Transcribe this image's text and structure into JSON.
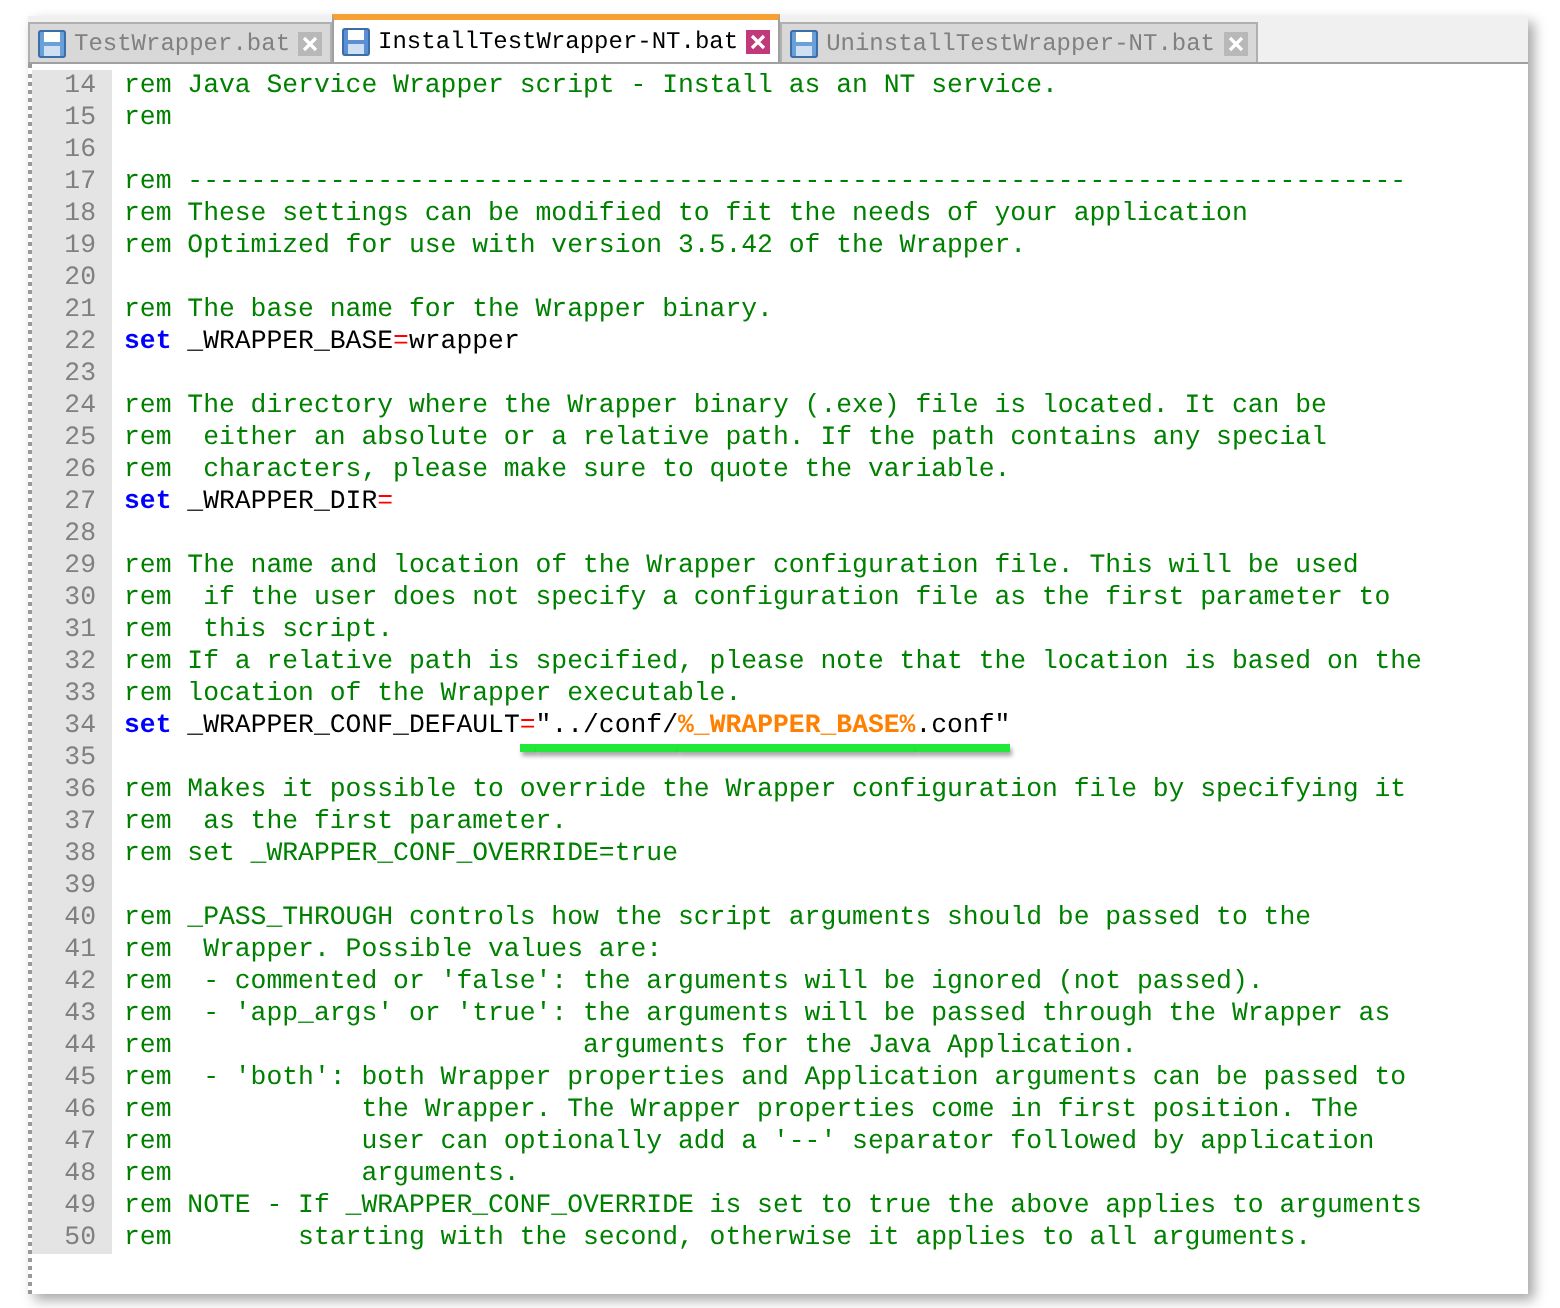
{
  "tabs": [
    {
      "label": "TestWrapper.bat",
      "selected": false
    },
    {
      "label": "InstallTestWrapper-NT.bat",
      "selected": true
    },
    {
      "label": "UninstallTestWrapper-NT.bat",
      "selected": false
    }
  ],
  "lines": [
    {
      "number": "14",
      "segments": [
        {
          "kind": "comment",
          "text": "rem Java Service Wrapper script - Install as an NT service."
        }
      ]
    },
    {
      "number": "15",
      "segments": [
        {
          "kind": "comment",
          "text": "rem"
        }
      ]
    },
    {
      "number": "16"
    },
    {
      "number": "17",
      "segments": [
        {
          "kind": "comment",
          "text": "rem -----------------------------------------------------------------------------"
        }
      ]
    },
    {
      "number": "18",
      "segments": [
        {
          "kind": "comment",
          "text": "rem These settings can be modified to fit the needs of your application"
        }
      ]
    },
    {
      "number": "19",
      "segments": [
        {
          "kind": "comment",
          "text": "rem Optimized for use with version 3.5.42 of the Wrapper."
        }
      ]
    },
    {
      "number": "20"
    },
    {
      "number": "21",
      "segments": [
        {
          "kind": "comment",
          "text": "rem The base name for the Wrapper binary."
        }
      ]
    },
    {
      "number": "22",
      "segments": [
        {
          "kind": "keyword",
          "text": "set"
        },
        {
          "kind": "plain",
          "text": " _WRAPPER_BASE"
        },
        {
          "kind": "operator",
          "text": "="
        },
        {
          "kind": "plain",
          "text": "wrapper"
        }
      ]
    },
    {
      "number": "23"
    },
    {
      "number": "24",
      "segments": [
        {
          "kind": "comment",
          "text": "rem The directory where the Wrapper binary (.exe) file is located. It can be"
        }
      ]
    },
    {
      "number": "25",
      "segments": [
        {
          "kind": "comment",
          "text": "rem  either an absolute or a relative path. If the path contains any special"
        }
      ]
    },
    {
      "number": "26",
      "segments": [
        {
          "kind": "comment",
          "text": "rem  characters, please make sure to quote the variable."
        }
      ]
    },
    {
      "number": "27",
      "segments": [
        {
          "kind": "keyword",
          "text": "set"
        },
        {
          "kind": "plain",
          "text": " _WRAPPER_DIR"
        },
        {
          "kind": "operator",
          "text": "="
        }
      ]
    },
    {
      "number": "28"
    },
    {
      "number": "29",
      "segments": [
        {
          "kind": "comment",
          "text": "rem The name and location of the Wrapper configuration file. This will be used"
        }
      ]
    },
    {
      "number": "30",
      "segments": [
        {
          "kind": "comment",
          "text": "rem  if the user does not specify a configuration file as the first parameter to"
        }
      ]
    },
    {
      "number": "31",
      "segments": [
        {
          "kind": "comment",
          "text": "rem  this script."
        }
      ]
    },
    {
      "number": "32",
      "segments": [
        {
          "kind": "comment",
          "text": "rem If a relative path is specified, please note that the location is based on the"
        }
      ]
    },
    {
      "number": "33",
      "segments": [
        {
          "kind": "comment",
          "text": "rem location of the Wrapper executable."
        }
      ]
    },
    {
      "number": "34",
      "segments": [
        {
          "kind": "keyword",
          "text": "set"
        },
        {
          "kind": "plain",
          "text": " _WRAPPER_CONF_DEFAULT"
        },
        {
          "kind": "operator",
          "text": "=",
          "underlined": true
        },
        {
          "kind": "plain",
          "text": "″../conf/",
          "underlined": true
        },
        {
          "kind": "variable",
          "text": "%_WRAPPER_BASE%",
          "underlined": true
        },
        {
          "kind": "plain",
          "text": ".conf″",
          "underlined": true
        }
      ]
    },
    {
      "number": "35"
    },
    {
      "number": "36",
      "segments": [
        {
          "kind": "comment",
          "text": "rem Makes it possible to override the Wrapper configuration file by specifying it"
        }
      ]
    },
    {
      "number": "37",
      "segments": [
        {
          "kind": "comment",
          "text": "rem  as the first parameter."
        }
      ]
    },
    {
      "number": "38",
      "segments": [
        {
          "kind": "comment",
          "text": "rem set _WRAPPER_CONF_OVERRIDE=true"
        }
      ]
    },
    {
      "number": "39"
    },
    {
      "number": "40",
      "segments": [
        {
          "kind": "comment",
          "text": "rem _PASS_THROUGH controls how the script arguments should be passed to the"
        }
      ]
    },
    {
      "number": "41",
      "segments": [
        {
          "kind": "comment",
          "text": "rem  Wrapper. Possible values are:"
        }
      ]
    },
    {
      "number": "42",
      "segments": [
        {
          "kind": "comment",
          "text": "rem  - commented or 'false': the arguments will be ignored (not passed)."
        }
      ]
    },
    {
      "number": "43",
      "segments": [
        {
          "kind": "comment",
          "text": "rem  - 'app_args' or 'true': the arguments will be passed through the Wrapper as"
        }
      ]
    },
    {
      "number": "44",
      "segments": [
        {
          "kind": "comment",
          "text": "rem                          arguments for the Java Application."
        }
      ]
    },
    {
      "number": "45",
      "segments": [
        {
          "kind": "comment",
          "text": "rem  - 'both': both Wrapper properties and Application arguments can be passed to"
        }
      ]
    },
    {
      "number": "46",
      "segments": [
        {
          "kind": "comment",
          "text": "rem            the Wrapper. The Wrapper properties come in first position. The"
        }
      ]
    },
    {
      "number": "47",
      "segments": [
        {
          "kind": "comment",
          "text": "rem            user can optionally add a '--' separator followed by application"
        }
      ]
    },
    {
      "number": "48",
      "segments": [
        {
          "kind": "comment",
          "text": "rem            arguments."
        }
      ]
    },
    {
      "number": "49",
      "segments": [
        {
          "kind": "comment",
          "text": "rem NOTE - If _WRAPPER_CONF_OVERRIDE is set to true the above applies to arguments"
        }
      ]
    },
    {
      "number": "50",
      "segments": [
        {
          "kind": "comment",
          "text": "rem        starting with the second, otherwise it applies to all arguments."
        }
      ]
    }
  ]
}
